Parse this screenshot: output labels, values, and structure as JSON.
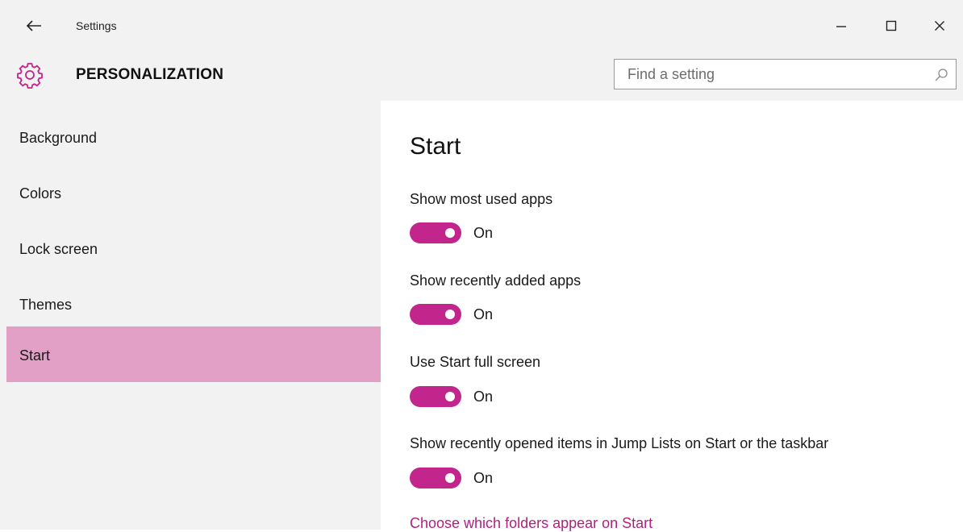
{
  "window": {
    "app_title": "Settings",
    "back_icon": "back-arrow-icon",
    "minimize_icon": "minimize-icon",
    "maximize_icon": "maximize-icon",
    "close_icon": "close-icon"
  },
  "header": {
    "icon": "gear-icon",
    "section_title": "PERSONALIZATION",
    "search_placeholder": "Find a setting",
    "search_value": "",
    "search_icon": "search-icon"
  },
  "colors": {
    "accent": "#c2258c",
    "selected_nav": "#e3a0c7",
    "link": "#b0207e",
    "chrome_bg": "#f2f2f2"
  },
  "sidebar": {
    "items": [
      {
        "label": "Background",
        "selected": false
      },
      {
        "label": "Colors",
        "selected": false
      },
      {
        "label": "Lock screen",
        "selected": false
      },
      {
        "label": "Themes",
        "selected": false
      },
      {
        "label": "Start",
        "selected": true
      }
    ]
  },
  "main": {
    "heading": "Start",
    "settings": [
      {
        "label": "Show most used apps",
        "state": "On",
        "on": true
      },
      {
        "label": "Show recently added apps",
        "state": "On",
        "on": true
      },
      {
        "label": "Use Start full screen",
        "state": "On",
        "on": true
      },
      {
        "label": "Show recently opened items in Jump Lists on Start or the taskbar",
        "state": "On",
        "on": true
      }
    ],
    "link": "Choose which folders appear on Start"
  }
}
